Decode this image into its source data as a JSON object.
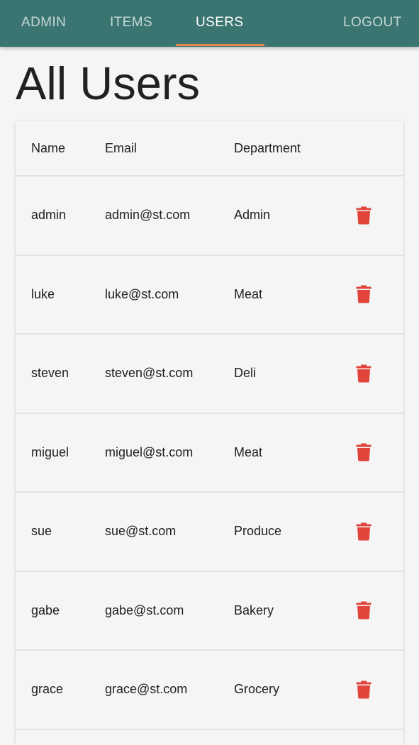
{
  "nav": {
    "items": [
      {
        "label": "ADMIN"
      },
      {
        "label": "ITEMS"
      },
      {
        "label": "USERS"
      }
    ],
    "logout_label": "LOGOUT",
    "active_tab": "USERS",
    "bar_color": "#3b7571",
    "underline_color": "#e8854a"
  },
  "page": {
    "title": "All Users"
  },
  "table": {
    "headers": {
      "name": "Name",
      "email": "Email",
      "department": "Department"
    },
    "rows": [
      {
        "name": "admin",
        "email": "admin@st.com",
        "department": "Admin"
      },
      {
        "name": "luke",
        "email": "luke@st.com",
        "department": "Meat"
      },
      {
        "name": "steven",
        "email": "steven@st.com",
        "department": "Deli"
      },
      {
        "name": "miguel",
        "email": "miguel@st.com",
        "department": "Meat"
      },
      {
        "name": "sue",
        "email": "sue@st.com",
        "department": "Produce"
      },
      {
        "name": "gabe",
        "email": "gabe@st.com",
        "department": "Bakery"
      },
      {
        "name": "grace",
        "email": "grace@st.com",
        "department": "Grocery"
      }
    ],
    "row_action_icon": "trash-icon",
    "delete_color": "#e0443a"
  }
}
